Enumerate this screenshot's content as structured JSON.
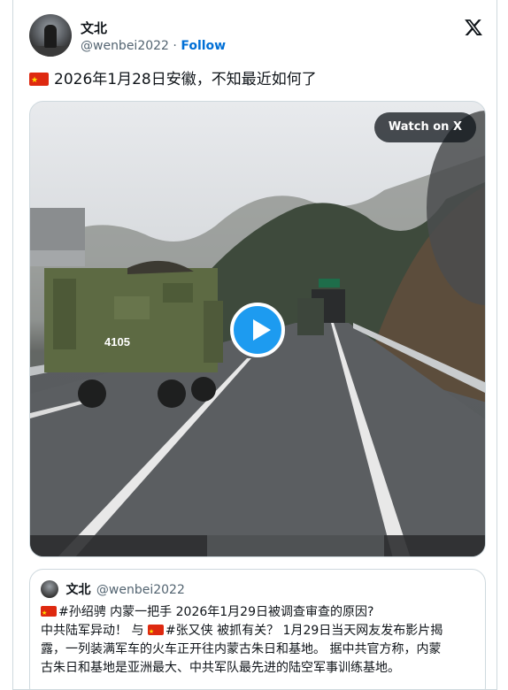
{
  "author": {
    "name": "文北",
    "handle": "@wenbei2022",
    "separator": "·",
    "follow_label": "Follow"
  },
  "tweet": {
    "text": "2026年1月28日安徽，不知最近如何了"
  },
  "media": {
    "watch_label": "Watch on X",
    "truck_number": "4105"
  },
  "quote": {
    "name": "文北",
    "handle": "@wenbei2022",
    "line1_tag": "#孙绍骋",
    "line1_rest": " 内蒙一把手 2026年1月29日被调查审查的原因?",
    "line2_a": "中共陆军异动！ 与 ",
    "line2_tag": "#张又侠",
    "line2_b": " 被抓有关？  1月29日当天网友发布影片揭",
    "line3": "露，一列装满军车的火车正开往内蒙古朱日和基地。 据中共官方称，内蒙",
    "line4": "古朱日和基地是亚洲最大、中共军队最先进的陆空军事训练基地。"
  },
  "icons": {
    "brand": "x-logo-icon",
    "flag": "china-flag-icon",
    "play": "play-icon"
  },
  "colors": {
    "accent": "#1d9bf0",
    "follow": "#006fd6",
    "muted": "#536471",
    "border": "#cfd9de"
  }
}
